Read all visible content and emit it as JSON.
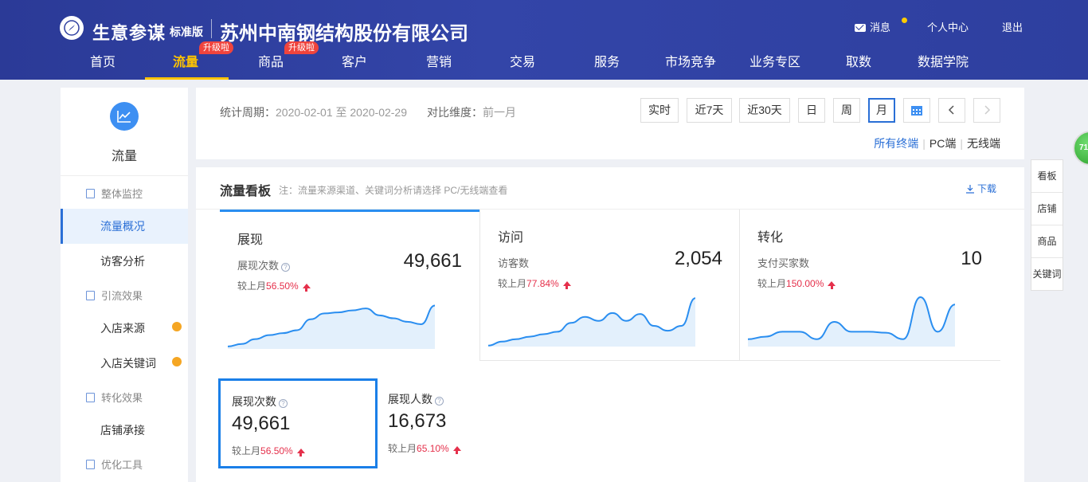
{
  "header": {
    "brand": "生意参谋",
    "edition": "标准版",
    "company": "苏州中南钢结构股份有限公司",
    "messages": "消息",
    "personal_center": "个人中心",
    "logout": "退出",
    "upgrade_badge": "升级啦"
  },
  "nav": {
    "items": [
      "首页",
      "流量",
      "商品",
      "客户",
      "营销",
      "交易",
      "服务",
      "市场竞争",
      "业务专区",
      "取数",
      "数据学院"
    ],
    "active": "流量"
  },
  "sidebar": {
    "title": "流量",
    "groups": {
      "overall": "整体监控",
      "traffic_effect": "引流效果",
      "conversion_effect": "转化效果",
      "optimize_tools": "优化工具"
    },
    "items": {
      "overview": "流量概况",
      "visitor_analysis": "访客分析",
      "store_source": "入店来源",
      "store_keywords": "入店关键词",
      "store_landing": "店铺承接"
    }
  },
  "period": {
    "label": "统计周期：",
    "value": "2020-02-01 至 2020-02-29",
    "compare_label": "对比维度：",
    "compare_value": "前一月",
    "buttons": [
      "实时",
      "近7天",
      "近30天",
      "日",
      "周",
      "月"
    ],
    "active": "月",
    "terminals": [
      "所有终端",
      "PC端",
      "无线端"
    ]
  },
  "board": {
    "title": "流量看板",
    "note": "注：流量来源渠道、关键词分析请选择 PC/无线端查看",
    "download": "下载",
    "compare_prefix": "较上月",
    "metrics": [
      {
        "title": "展现",
        "sub": "展现次数",
        "value": "49,661",
        "change": "56.50%",
        "trend": [
          0.05,
          0.1,
          0.2,
          0.28,
          0.32,
          0.38,
          0.6,
          0.72,
          0.74,
          0.78,
          0.82,
          0.68,
          0.62,
          0.55,
          0.5,
          0.88
        ]
      },
      {
        "title": "访问",
        "sub": "访客数",
        "value": "2,054",
        "change": "77.84%",
        "trend": [
          0.02,
          0.1,
          0.15,
          0.2,
          0.25,
          0.3,
          0.48,
          0.6,
          0.52,
          0.68,
          0.52,
          0.66,
          0.42,
          0.32,
          0.42,
          0.98
        ]
      },
      {
        "title": "转化",
        "sub": "支付买家数",
        "value": "10",
        "change": "150.00%",
        "trend": [
          0.15,
          0.2,
          0.3,
          0.3,
          0.15,
          0.5,
          0.3,
          0.3,
          0.28,
          0.15,
          1.0,
          0.3,
          0.85
        ]
      }
    ],
    "mini": [
      {
        "title": "展现次数",
        "value": "49,661",
        "change": "56.50%"
      },
      {
        "title": "展现人数",
        "value": "16,673",
        "change": "65.10%"
      }
    ]
  },
  "right_tabs": [
    "看板",
    "店铺",
    "商品",
    "关键词"
  ],
  "floating_badge": "71",
  "colors": {
    "header": "#2e3f9f",
    "accent": "#2a6fd6",
    "active_nav": "#ffc400",
    "up": "#e5304b",
    "chart_fill": "#e3f0fc",
    "chart_line": "#2a8ef0"
  }
}
